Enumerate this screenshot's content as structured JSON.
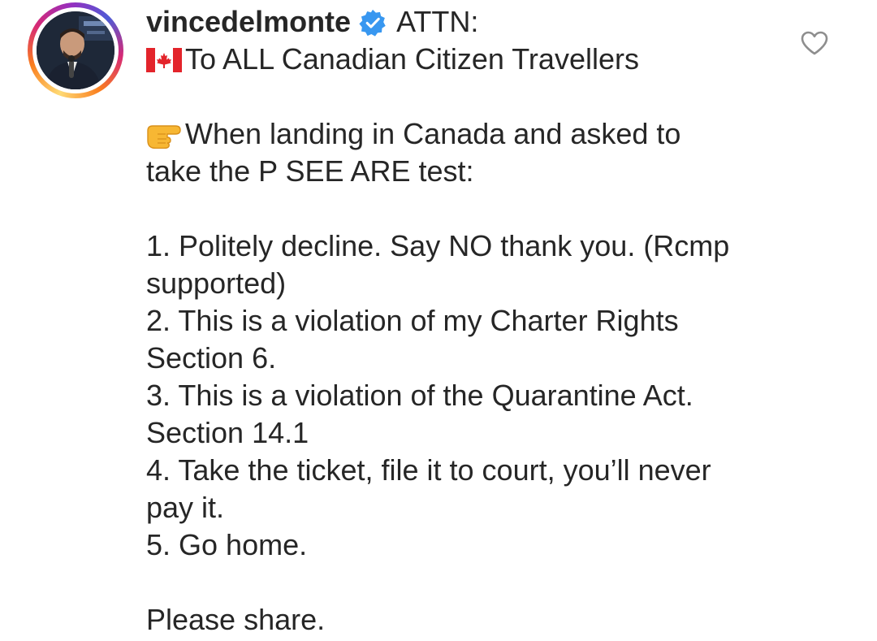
{
  "post": {
    "username": "vincedelmonte",
    "verified_badge": "verified-check-icon",
    "header_text": "ATTN:",
    "lines": [
      {
        "icon": "canada-flag-icon",
        "text": "To ALL Canadian Citizen Travellers"
      },
      {
        "icon": null,
        "text": ""
      },
      {
        "icon": "pointing-hand-icon",
        "text": "When landing in Canada and asked to"
      },
      {
        "icon": null,
        "text": "take the P SEE ARE test:"
      },
      {
        "icon": null,
        "text": ""
      },
      {
        "icon": null,
        "text": "1. Politely decline. Say NO thank you. (Rcmp"
      },
      {
        "icon": null,
        "text": "supported)"
      },
      {
        "icon": null,
        "text": "2. This is a violation of my Charter Rights"
      },
      {
        "icon": null,
        "text": "Section 6."
      },
      {
        "icon": null,
        "text": "3. This is a violation of the Quarantine Act."
      },
      {
        "icon": null,
        "text": "Section 14.1"
      },
      {
        "icon": null,
        "text": "4. Take the ticket, file it to court, you’ll never"
      },
      {
        "icon": null,
        "text": "pay it."
      },
      {
        "icon": null,
        "text": "5. Go home."
      },
      {
        "icon": null,
        "text": ""
      },
      {
        "icon": null,
        "text": "Please share."
      }
    ],
    "like_icon": "heart-outline-icon"
  },
  "colors": {
    "text": "#262626",
    "verified_blue": "#3897f0",
    "heart_stroke": "#8e8e8e"
  }
}
